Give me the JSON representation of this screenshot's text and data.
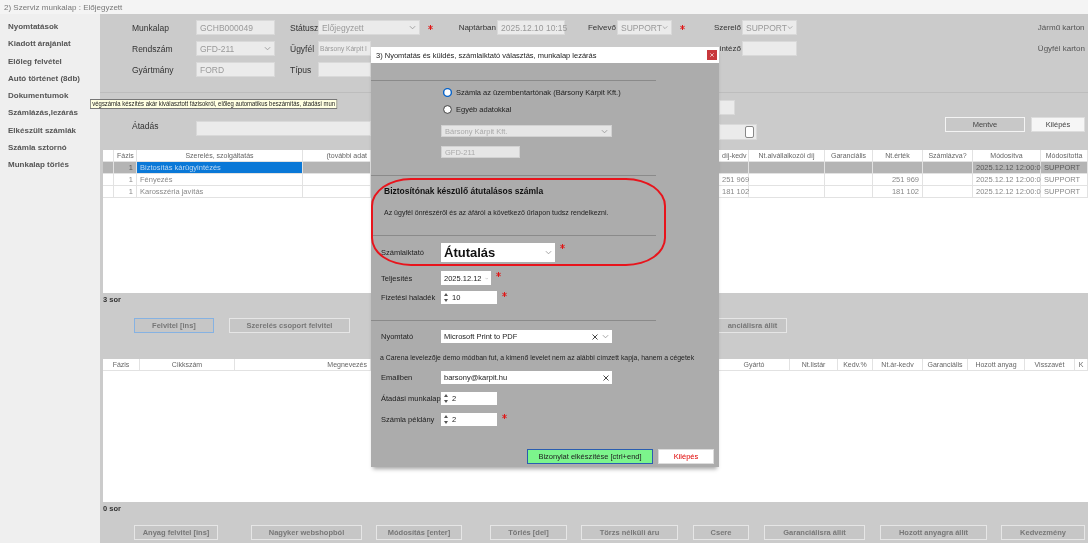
{
  "window": {
    "title": "2)  Szerviz munkalap : Előjegyzett"
  },
  "sidebar": {
    "items": [
      "Nyomtatások",
      "Kiadott árajánlat",
      "Előleg felvétel",
      "Autó történet (8db)",
      "Dokumentumok",
      "Számlázás,lezárás",
      "Elkészült számlák",
      "Számla sztornó",
      "Munkalap törlés"
    ]
  },
  "form": {
    "fields": [
      {
        "label": "Munkalap",
        "value": "GCHB000049",
        "kind": "text"
      },
      {
        "label": "Státusz",
        "value": "Előjegyzett",
        "kind": "select",
        "required": true
      },
      {
        "label": "Naptárban",
        "value": "2025.12.10 10:15",
        "kind": "select"
      },
      {
        "label": "Felvevő",
        "value": "SUPPORT",
        "kind": "select",
        "required": true
      },
      {
        "label": "Szerelő",
        "value": "SUPPORT",
        "kind": "select"
      },
      {
        "label": "Rendszám",
        "value": "GFD-211",
        "kind": "select"
      },
      {
        "label": "Ügyfél",
        "value": "Bársony Kárpit I",
        "kind": "text"
      },
      {
        "label": "intéző",
        "kind": "text"
      },
      {
        "label": "Gyártmány",
        "value": "FORD",
        "kind": "text"
      },
      {
        "label": "Típus",
        "kind": "text"
      }
    ],
    "links": [
      "Jármű karton",
      "Ügyfél karton"
    ]
  },
  "tooltip": "végszámla készítés akár kiválasztott fázisokról, előleg automatikus beszámítás, átadási mun",
  "handover": {
    "label": "Átadás"
  },
  "actions": [
    {
      "label": "Mentve",
      "kind": "default"
    },
    {
      "label": "Kilépés",
      "kind": "light"
    }
  ],
  "services_table": {
    "columns": [
      "Fázis",
      "Szerelés, szolgáltatás",
      "(további adat",
      "díj-kedv",
      "Nt.alvállalkozói díj",
      "Garanciális",
      "Nt.érték",
      "Számlázva?",
      "Módosítva",
      "Módosította"
    ],
    "rows": [
      {
        "selected": true,
        "phase": "1",
        "name": "Biztosítás kárügyintézés",
        "modified": "2025.12.12 12:00:0",
        "modified_by": "SUPPORT"
      },
      {
        "selected": false,
        "phase": "1",
        "name": "Fényezés",
        "fee": "251 969",
        "net_value": "251 969",
        "modified": "2025.12.12 12:00:0",
        "modified_by": "SUPPORT"
      },
      {
        "selected": false,
        "phase": "1",
        "name": "Karosszéria javítás",
        "fee": "181 102",
        "net_value": "181 102",
        "modified": "2025.12.12 12:00:0",
        "modified_by": "SUPPORT"
      }
    ],
    "row_count": "3 sor",
    "buttons": [
      {
        "label": "Felvitel [ins]",
        "focused": true
      },
      {
        "label": "Szerelés csoport felvitel",
        "focused": false
      },
      {
        "label": "anciálisra állít",
        "focused": false
      }
    ]
  },
  "parts_table": {
    "columns": [
      "Fázis",
      "Cikkszám",
      "Megnevezés",
      "Gyártó",
      "Nt.listár",
      "Kedv.%",
      "Nt.ár-kedv",
      "Garanciális",
      "Hozott anyag",
      "Visszavét",
      "K"
    ],
    "row_count": "0 sor",
    "buttons": [
      "Anyag felvitel [ins]",
      "Nagyker webshopból",
      "Módosítás [enter]",
      "Törlés [del]",
      "Törzs nélküli áru",
      "Csere",
      "Garanciálisra állít",
      "Hozott anyagra állít",
      "Kedvezmény"
    ]
  },
  "dialog": {
    "title": "3)  Nyomtatás és küldés, számlaiktató választás, munkalap lezárás",
    "recipients": [
      {
        "label": "Számla az üzembentartónak (Bársony Kárpit Kft.)",
        "selected": true
      },
      {
        "label": "Egyéb adatokkal",
        "selected": false
      }
    ],
    "customer_select": "Bársony Kárpit Kft.",
    "plate": "GFD-211",
    "notice": {
      "heading": "Biztosítónak készülő átutalásos számla",
      "text": "Az ügyfél önrészéről és az áfáról a következő űrlapon tudsz rendelkezni."
    },
    "invoice_fields": [
      {
        "kind": "big-select",
        "label": "Számlaiktató",
        "value": "Átutalás",
        "required": true
      },
      {
        "kind": "date",
        "label": "Teljesítés",
        "value": "2025.12.12",
        "required": true
      },
      {
        "kind": "number",
        "label": "Fizetési haladék",
        "value": "10",
        "required": true
      }
    ],
    "printer": {
      "kind": "clearable-select",
      "label": "Nyomtató",
      "value": "Microsoft Print to PDF"
    },
    "mail_notice": "a Carena levelezője demo módban fut, a kimenő levelet nem az alábbi címzett kapja, hanem a cégetek",
    "send_fields": [
      {
        "kind": "email",
        "label": "Emailben",
        "value": "barsony@karpit.hu"
      },
      {
        "kind": "number",
        "label": "Átadási munkalap",
        "value": "2",
        "required": false
      },
      {
        "kind": "number",
        "label": "Számla példány",
        "value": "2",
        "required": true
      }
    ],
    "buttons": [
      {
        "label": "Bizonylat elkészítése [ctrl+end]",
        "kind": "primary"
      },
      {
        "label": "Kilépés",
        "kind": "cancel"
      }
    ]
  }
}
